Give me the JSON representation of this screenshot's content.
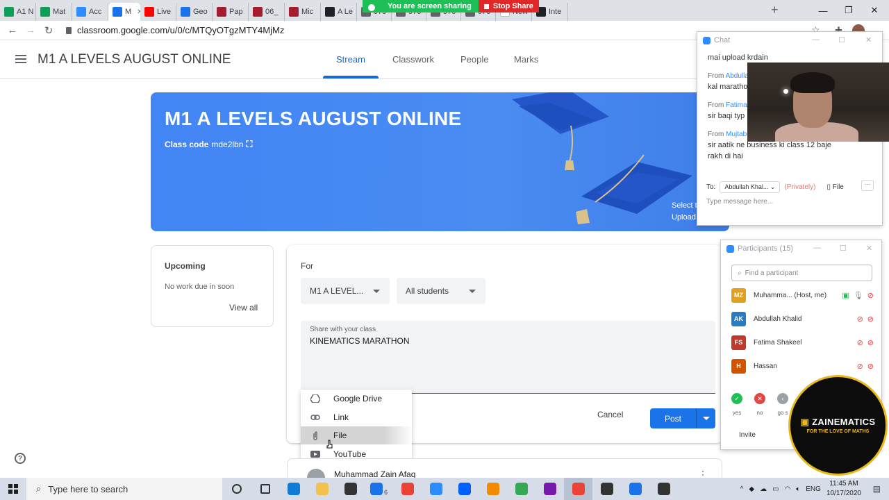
{
  "browser": {
    "tabs": [
      {
        "label": "A1 N",
        "color": "#0f9d58"
      },
      {
        "label": "Mat",
        "color": "#0f9d58"
      },
      {
        "label": "Acc",
        "color": "#2d8cff"
      },
      {
        "label": "M",
        "color": "#1a73e8",
        "active": true
      },
      {
        "label": "Live",
        "color": "#ff0000"
      },
      {
        "label": "Geo",
        "color": "#1a73e8"
      },
      {
        "label": "Pap",
        "color": "#a51c30"
      },
      {
        "label": "06_",
        "color": "#a51c30"
      },
      {
        "label": "Mic",
        "color": "#a51c30"
      },
      {
        "label": "A Le",
        "color": "#202124"
      },
      {
        "label": "970",
        "color": "#5f6368"
      },
      {
        "label": "970",
        "color": "#5f6368"
      },
      {
        "label": "970",
        "color": "#5f6368"
      },
      {
        "label": "970",
        "color": "#5f6368"
      },
      {
        "label": "New Tab",
        "color": "#ffffff"
      },
      {
        "label": "Inte",
        "color": "#202124"
      }
    ],
    "sharing_text": "You are screen sharing",
    "stop_share": "Stop Share",
    "url": "classroom.google.com/u/0/c/MTQyOTgzMTY4MjMz"
  },
  "classroom": {
    "class_title": "M1 A LEVELS AUGUST ONLINE",
    "tabs": [
      "Stream",
      "Classwork",
      "People",
      "Marks"
    ],
    "banner": {
      "title": "M1 A LEVELS AUGUST ONLINE",
      "class_code_label": "Class code",
      "class_code": "mde2lbn",
      "select_text": "Select t",
      "upload_text": "Upload"
    },
    "upcoming": {
      "title": "Upcoming",
      "empty": "No work due in soon",
      "view_all": "View all"
    },
    "composer": {
      "for_label": "For",
      "class_select": "M1 A LEVEL...",
      "students_select": "All students",
      "share_label": "Share with your class",
      "share_text": "KINEMATICS MARATHON",
      "cancel": "Cancel",
      "post": "Post"
    },
    "attach_menu": [
      {
        "label": "Google Drive",
        "icon": "drive-icon"
      },
      {
        "label": "Link",
        "icon": "link-icon"
      },
      {
        "label": "File",
        "icon": "paperclip-icon",
        "highlighted": true
      },
      {
        "label": "YouTube",
        "icon": "youtube-icon"
      }
    ],
    "stream_author": "Muhammad Zain Afaq"
  },
  "zoom_chat": {
    "title": "Chat",
    "messages": [
      {
        "text": "mai upload krdain"
      },
      {
        "from": "Abdullah",
        "text": "kal marathon"
      },
      {
        "from": "Fatima",
        "text": "sir baqi typ"
      },
      {
        "from": "Mujtab",
        "text": "sir aatik ne business ki class 12 baje"
      },
      {
        "text": "rakh di hai"
      }
    ],
    "from_label": "From",
    "to_label": "To:",
    "to_value": "Abdullah Khal...",
    "privately": "(Privately)",
    "file": "File",
    "placeholder": "Type message here..."
  },
  "zoom_participants": {
    "title": "Participants (15)",
    "search_placeholder": "Find a participant",
    "participants": [
      {
        "initials": "MZ",
        "name": "Muhamma...",
        "role": "(Host, me)",
        "color": "#e0a020"
      },
      {
        "initials": "AK",
        "name": "Abdullah Khalid",
        "color": "#2b7bc0"
      },
      {
        "initials": "FS",
        "name": "Fatima Shakeel",
        "color": "#c0392b"
      },
      {
        "initials": "H",
        "name": "Hassan",
        "color": "#d35400"
      }
    ],
    "reactions": [
      {
        "label": "yes",
        "color": "#1fbf57",
        "symbol": "✓"
      },
      {
        "label": "no",
        "color": "#e04848",
        "symbol": "✕"
      },
      {
        "label": "go s",
        "color": "#9aa0a6",
        "symbol": "‹"
      }
    ],
    "invite": "Invite"
  },
  "logo": {
    "name": "ZAINEMATICS",
    "tagline": "FOR THE LOVE OF MATHS"
  },
  "taskbar": {
    "search": "Type here to search",
    "time": "11:45 AM",
    "date": "10/17/2020",
    "mail_badge": "6",
    "apps": [
      {
        "name": "cortana-icon",
        "color": "#333333"
      },
      {
        "name": "task-view-icon",
        "color": "#333333"
      },
      {
        "name": "edge-icon",
        "color": "#0f7bd6"
      },
      {
        "name": "file-explorer-icon",
        "color": "#f2c14e"
      },
      {
        "name": "store-icon",
        "color": "#333333"
      },
      {
        "name": "mail-icon",
        "color": "#1a73e8"
      },
      {
        "name": "chrome-icon",
        "color": "#ea4335"
      },
      {
        "name": "zoom-icon",
        "color": "#2d8cff"
      },
      {
        "name": "dropbox-icon",
        "color": "#0061fe"
      },
      {
        "name": "vlc-icon",
        "color": "#f28b00"
      },
      {
        "name": "chrome-profile-icon",
        "color": "#34a853"
      },
      {
        "name": "onenote-icon",
        "color": "#7719aa"
      },
      {
        "name": "chrome-active-icon",
        "color": "#ea4335"
      },
      {
        "name": "obs-icon",
        "color": "#333333"
      },
      {
        "name": "whiteboard-icon",
        "color": "#1a73e8"
      },
      {
        "name": "settings-icon",
        "color": "#333333"
      }
    ]
  }
}
